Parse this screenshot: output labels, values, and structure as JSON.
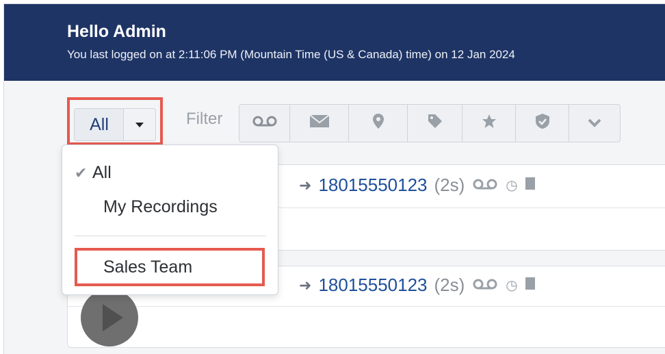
{
  "header": {
    "greeting": "Hello Admin",
    "last_login": "You last logged on at 2:11:06 PM (Mountain Time (US & Canada) time) on 12 Jan 2024"
  },
  "toolbar": {
    "all_button": "All",
    "filter_label": "Filter",
    "filter_icons": [
      "voicemail-icon",
      "envelope-icon",
      "location-pin-icon",
      "tag-icon",
      "star-icon",
      "shield-check-icon",
      "chevron-down-icon"
    ]
  },
  "dropdown": {
    "items": [
      {
        "label": "All",
        "checked": true
      },
      {
        "label": "My Recordings",
        "checked": false
      },
      {
        "label": "Sales Team",
        "checked": false
      }
    ]
  },
  "recordings": [
    {
      "number": "18015550123",
      "duration": "(2s)"
    },
    {
      "number": "18015550123",
      "duration": "(2s)"
    }
  ],
  "colors": {
    "header_bg": "#1e3465",
    "highlight": "#e55a4f",
    "link": "#1e4f9a"
  }
}
